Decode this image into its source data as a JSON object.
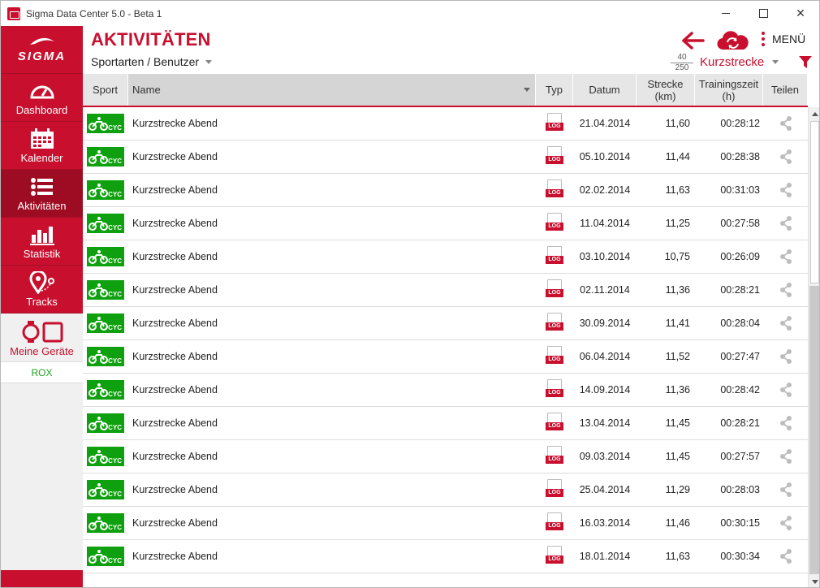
{
  "window": {
    "title": "Sigma Data Center 5.0 - Beta 1",
    "close_glyph": "✕"
  },
  "sidebar": {
    "logo": "SIGMA",
    "items": [
      {
        "label": "Dashboard",
        "icon": "speedometer-icon"
      },
      {
        "label": "Kalender",
        "icon": "calendar-icon"
      },
      {
        "label": "Aktivitäten",
        "icon": "list-icon",
        "active": true
      },
      {
        "label": "Statistik",
        "icon": "bar-chart-icon"
      },
      {
        "label": "Tracks",
        "icon": "map-pin-icon"
      }
    ],
    "devices": {
      "label": "Meine Geräte",
      "icon": "devices-icon"
    },
    "device_list": [
      "ROX"
    ]
  },
  "header": {
    "title": "AKTIVITÄTEN",
    "breadcrumb": "Sportarten / Benutzer",
    "menu_label": "MENÜ",
    "counter_top": "40",
    "counter_bottom": "250",
    "filter_name": "Kurzstrecke"
  },
  "colors": {
    "brand": "#c8102e",
    "sport_green": "#0ea00e"
  },
  "table": {
    "columns": {
      "sport": "Sport",
      "name": "Name",
      "typ": "Typ",
      "datum": "Datum",
      "strecke_line1": "Strecke",
      "strecke_line2": "(km)",
      "zeit_line1": "Trainingszeit",
      "zeit_line2": "(h)",
      "teilen": "Teilen"
    },
    "rows": [
      {
        "sport": "CYC",
        "name": "Kurzstrecke Abend",
        "typ": "LOG",
        "datum": "21.04.2014",
        "strecke": "11,60",
        "zeit": "00:28:12"
      },
      {
        "sport": "CYC",
        "name": "Kurzstrecke Abend",
        "typ": "LOG",
        "datum": "05.10.2014",
        "strecke": "11,44",
        "zeit": "00:28:38"
      },
      {
        "sport": "CYC",
        "name": "Kurzstrecke Abend",
        "typ": "LOG",
        "datum": "02.02.2014",
        "strecke": "11,63",
        "zeit": "00:31:03"
      },
      {
        "sport": "CYC",
        "name": "Kurzstrecke Abend",
        "typ": "LOG",
        "datum": "11.04.2014",
        "strecke": "11,25",
        "zeit": "00:27:58"
      },
      {
        "sport": "CYC",
        "name": "Kurzstrecke Abend",
        "typ": "LOG",
        "datum": "03.10.2014",
        "strecke": "10,75",
        "zeit": "00:26:09"
      },
      {
        "sport": "CYC",
        "name": "Kurzstrecke Abend",
        "typ": "LOG",
        "datum": "02.11.2014",
        "strecke": "11,36",
        "zeit": "00:28:21"
      },
      {
        "sport": "CYC",
        "name": "Kurzstrecke Abend",
        "typ": "LOG",
        "datum": "30.09.2014",
        "strecke": "11,41",
        "zeit": "00:28:04"
      },
      {
        "sport": "CYC",
        "name": "Kurzstrecke Abend",
        "typ": "LOG",
        "datum": "06.04.2014",
        "strecke": "11,52",
        "zeit": "00:27:47"
      },
      {
        "sport": "CYC",
        "name": "Kurzstrecke Abend",
        "typ": "LOG",
        "datum": "14.09.2014",
        "strecke": "11,36",
        "zeit": "00:28:42"
      },
      {
        "sport": "CYC",
        "name": "Kurzstrecke Abend",
        "typ": "LOG",
        "datum": "13.04.2014",
        "strecke": "11,45",
        "zeit": "00:28:21"
      },
      {
        "sport": "CYC",
        "name": "Kurzstrecke Abend",
        "typ": "LOG",
        "datum": "09.03.2014",
        "strecke": "11,45",
        "zeit": "00:27:57"
      },
      {
        "sport": "CYC",
        "name": "Kurzstrecke Abend",
        "typ": "LOG",
        "datum": "25.04.2014",
        "strecke": "11,29",
        "zeit": "00:28:03"
      },
      {
        "sport": "CYC",
        "name": "Kurzstrecke Abend",
        "typ": "LOG",
        "datum": "16.03.2014",
        "strecke": "11,46",
        "zeit": "00:30:15"
      },
      {
        "sport": "CYC",
        "name": "Kurzstrecke Abend",
        "typ": "LOG",
        "datum": "18.01.2014",
        "strecke": "11,63",
        "zeit": "00:30:34"
      }
    ]
  }
}
